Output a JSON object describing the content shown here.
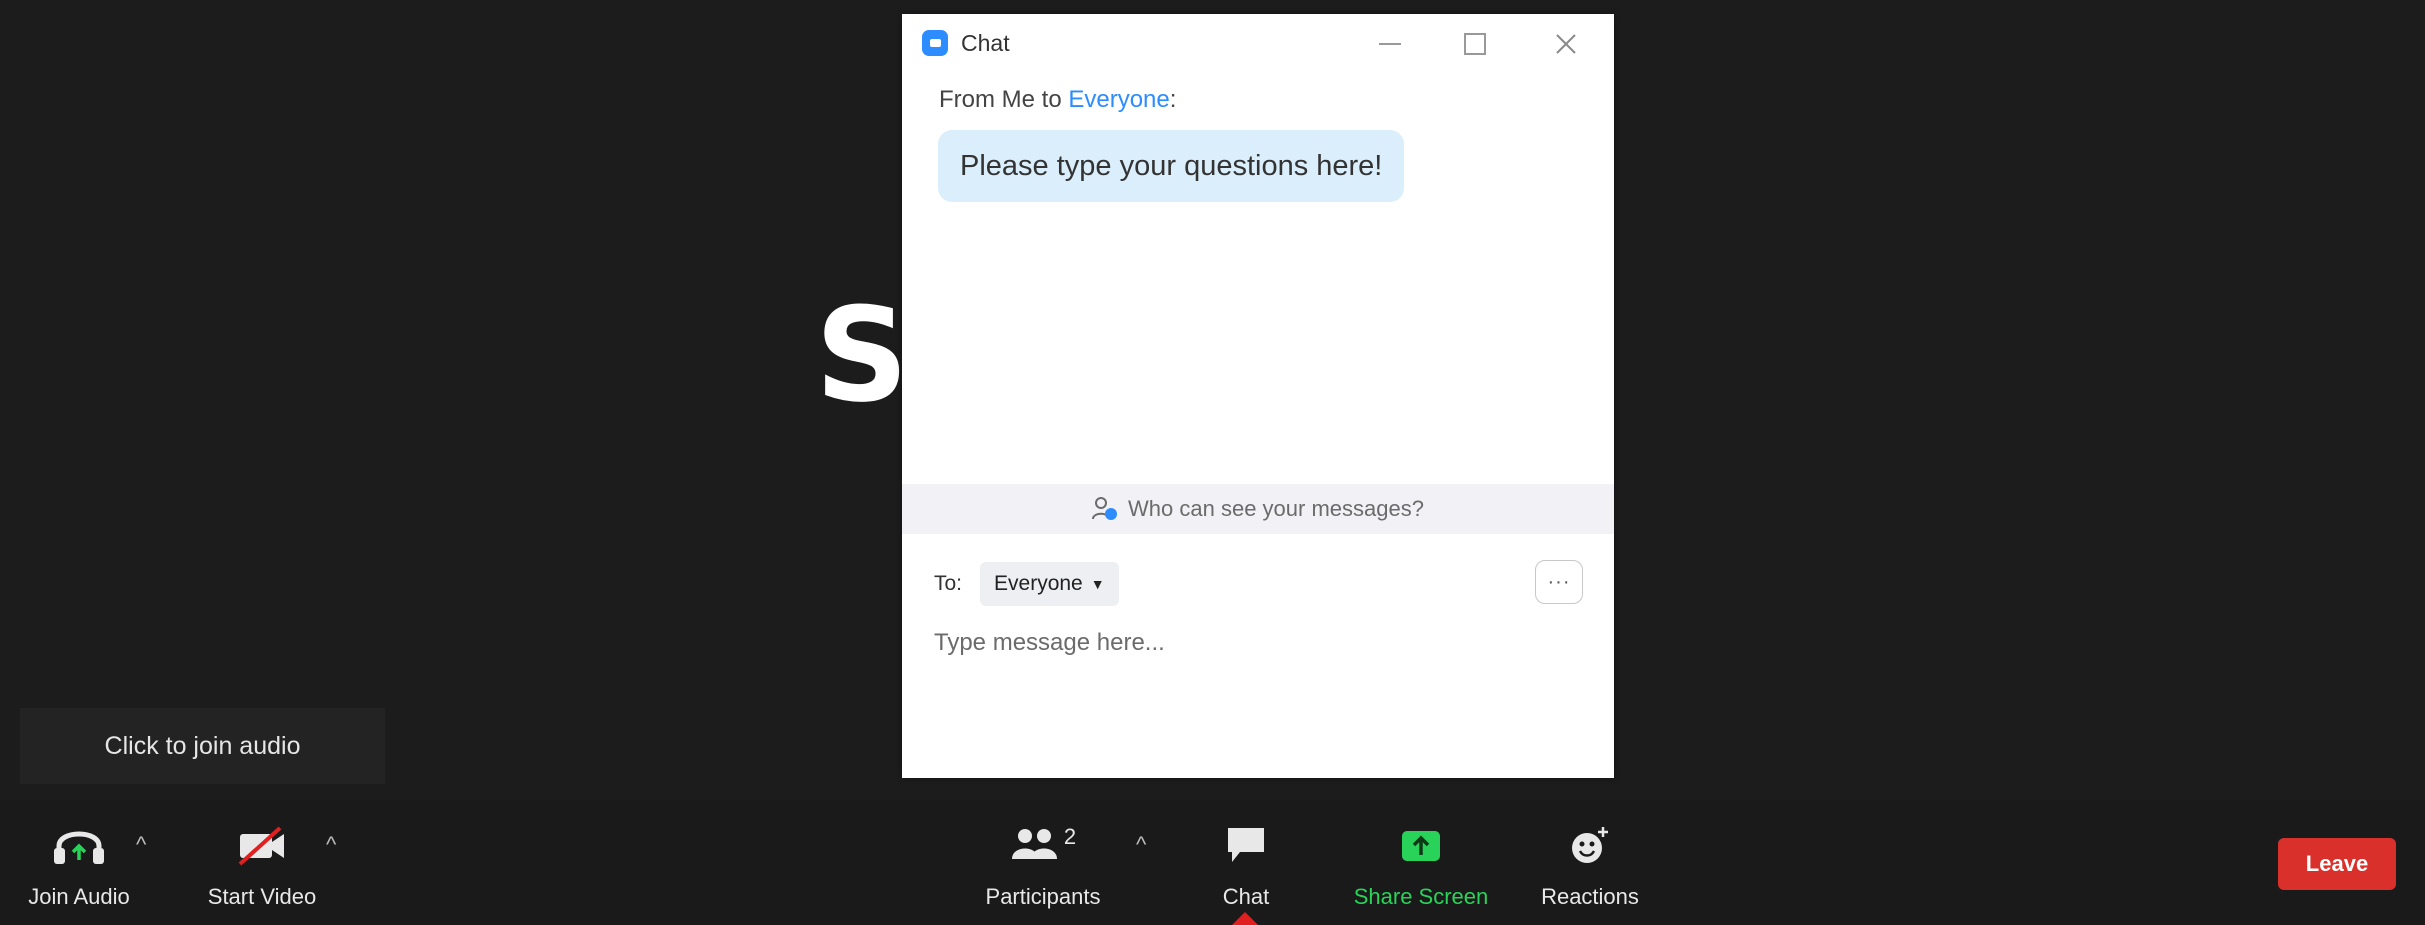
{
  "speaker": {
    "name_visible": "S"
  },
  "join_tooltip": "Click to join audio",
  "chat": {
    "title": "Chat",
    "message_from": "From Me to ",
    "message_recipient": "Everyone",
    "message_suffix": ":",
    "message_text": "Please type your questions here!",
    "visibility_prompt": "Who can see your messages?",
    "to_label": "To:",
    "to_selected": "Everyone",
    "more_label": "···",
    "input_placeholder": "Type message here..."
  },
  "toolbar": {
    "join_audio_label": "Join Audio",
    "start_video_label": "Start Video",
    "participants_label": "Participants",
    "participants_count": "2",
    "chat_label": "Chat",
    "share_screen_label": "Share Screen",
    "reactions_label": "Reactions",
    "leave_label": "Leave"
  },
  "colors": {
    "accent_blue": "#2d8cff",
    "share_green": "#29d35a",
    "leave_red": "#d9302c",
    "background": "#1a1a1a"
  }
}
